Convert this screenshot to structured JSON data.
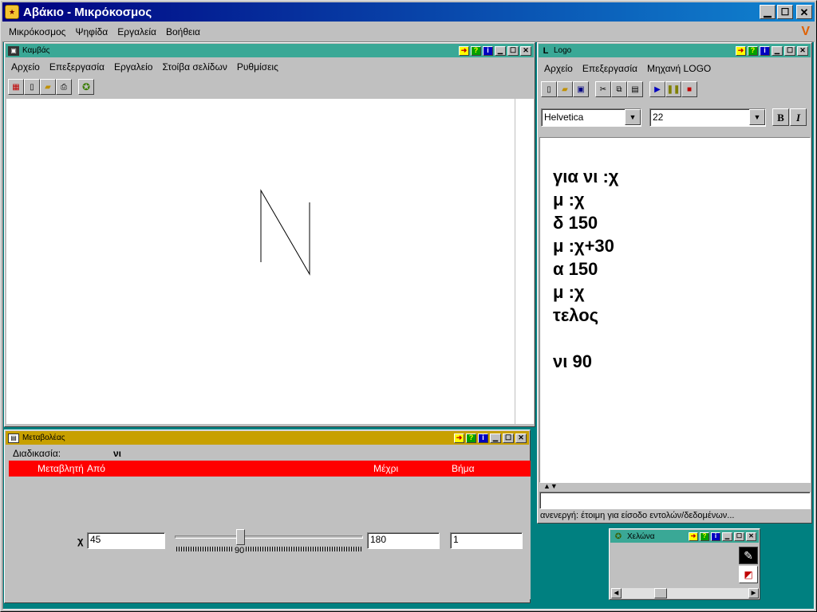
{
  "app": {
    "title": "Αβάκιο - Μικρόκοσμος",
    "menu": [
      "Μικρόκοσμος",
      "Ψηφίδα",
      "Εργαλεία",
      "Βοήθεια"
    ]
  },
  "canvas_window": {
    "title": "Καμβάς",
    "menu": [
      "Αρχείο",
      "Επεξεργασία",
      "Εργαλείο",
      "Στοίβα σελίδων",
      "Ρυθμίσεις"
    ]
  },
  "variator_window": {
    "title": "Μεταβολέας",
    "procedure_label": "Διαδικασία:",
    "procedure_name": "νι",
    "headers": {
      "variable": "Μεταβλητή",
      "from": "Από",
      "to": "Μέχρι",
      "step": "Βήμα"
    },
    "row": {
      "name": "χ",
      "from": "45",
      "slider_value": "90",
      "to": "180",
      "step": "1"
    },
    "slider_fraction": 0.34
  },
  "logo_window": {
    "title": "Logo",
    "menu": [
      "Αρχείο",
      "Επεξεργασία",
      "Μηχανή LOGO"
    ],
    "font_name": "Helvetica",
    "font_size": "22",
    "bold_label": "B",
    "italic_label": "I",
    "code_lines": [
      "για νι :χ",
      "μ :χ",
      "δ 150",
      "μ :χ+30",
      "α 150",
      "μ :χ",
      "τελος",
      "",
      "νι 90"
    ],
    "status": "ανενεργή: έτοιμη για είσοδο εντολών/δεδομένων..."
  },
  "turtle_window": {
    "title": "Χελώνα"
  },
  "colors": {
    "app_title_from": "#000080",
    "app_title_to": "#1084d0",
    "teal_bg": "#008080",
    "canvas_title": "#2a9d8f",
    "variator_title": "#c8a000",
    "header_red": "#ff0000"
  }
}
